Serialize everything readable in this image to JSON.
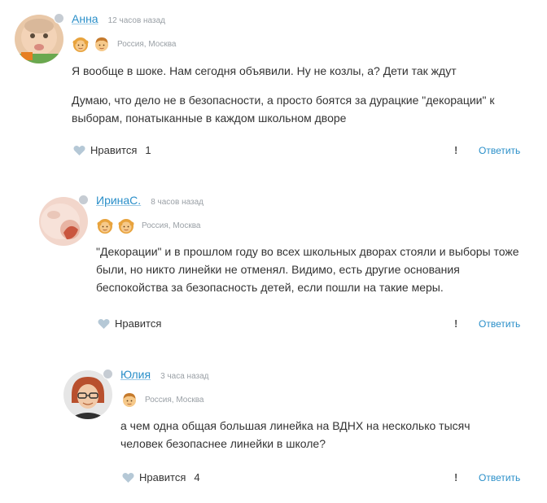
{
  "comments": [
    {
      "author": "Анна",
      "time": "12 часов назад",
      "location": "Россия, Москва",
      "kids": [
        "girl-child-icon",
        "boy-child-icon"
      ],
      "paragraphs": [
        "Я вообще в шоке. Нам сегодня объявили. Ну не козлы, а? Дети так ждут",
        "Думаю, что дело не в безопасности, а просто боятся за дурацкие \"декорации\" к выборам, понатыканные в каждом школьном дворе"
      ],
      "like_label": "Нравится",
      "like_count": "1",
      "report_label": "!",
      "reply_label": "Ответить"
    },
    {
      "author": "ИринаС.",
      "time": "8 часов назад",
      "location": "Россия, Москва",
      "kids": [
        "girl-child-icon",
        "girl-child-icon"
      ],
      "paragraphs": [
        "\"Декорации\" и в прошлом году во всех школьных дворах стояли и выборы тоже были, но никто линейки не отменял. Видимо, есть другие основания беспокойства за безопасность детей, если пошли на такие меры."
      ],
      "like_label": "Нравится",
      "like_count": "",
      "report_label": "!",
      "reply_label": "Ответить"
    },
    {
      "author": "Юлия",
      "time": "3 часа назад",
      "location": "Россия, Москва",
      "kids": [
        "boy-child-icon"
      ],
      "paragraphs": [
        "а чем одна общая большая линейка на ВДНХ на несколько тысяч человек безопаснее линейки в школе?"
      ],
      "like_label": "Нравится",
      "like_count": "4",
      "report_label": "!",
      "reply_label": "Ответить"
    }
  ],
  "colors": {
    "link": "#2a8fc9",
    "heart": "#b5c8d6",
    "muted": "#9aa0a6",
    "text": "#333333"
  }
}
